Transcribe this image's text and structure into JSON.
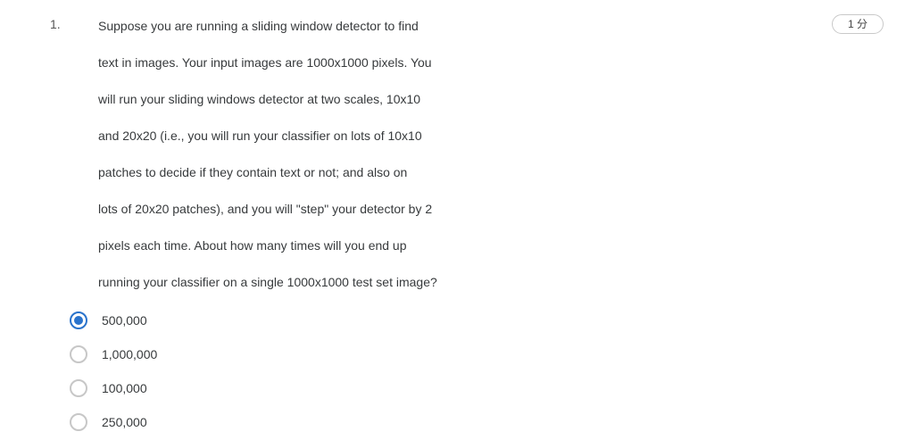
{
  "question": {
    "number": "1.",
    "points": "1 分",
    "lines": [
      "Suppose you are running a sliding window detector to find",
      "text in images.  Your input images are 1000x1000 pixels.  You",
      "will run your sliding windows detector at two scales, 10x10",
      "and 20x20 (i.e., you will run your classifier on lots of 10x10",
      "patches to decide if they contain text or not; and also on",
      "lots of 20x20 patches), and you will \"step\" your detector by 2",
      "pixels each time.  About how many times will you end up",
      "running your classifier on a single 1000x1000 test set image?"
    ],
    "options": [
      {
        "label": "500,000",
        "selected": true
      },
      {
        "label": "1,000,000",
        "selected": false
      },
      {
        "label": "100,000",
        "selected": false
      },
      {
        "label": "250,000",
        "selected": false
      }
    ]
  },
  "colors": {
    "accent": "#2a73cc",
    "radio_border": "#c7c7c7",
    "text": "#373a3c"
  }
}
